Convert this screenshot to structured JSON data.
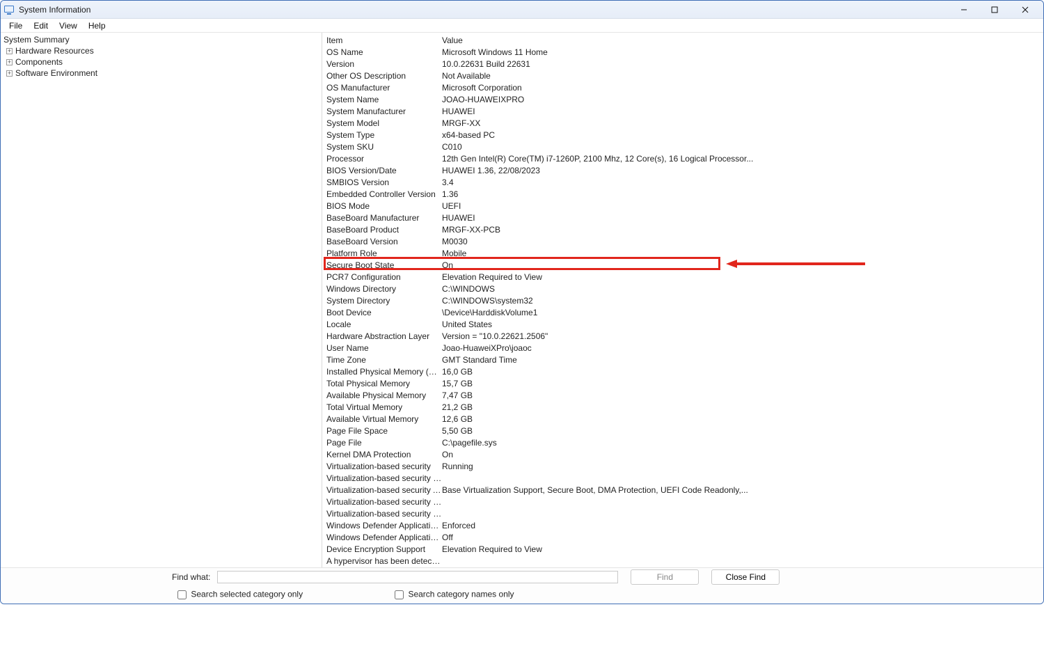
{
  "window": {
    "title": "System Information"
  },
  "menu": {
    "file": "File",
    "edit": "Edit",
    "view": "View",
    "help": "Help"
  },
  "tree": {
    "root": "System Summary",
    "hardware": "Hardware Resources",
    "components": "Components",
    "software": "Software Environment"
  },
  "columns": {
    "item": "Item",
    "value": "Value"
  },
  "rows": [
    {
      "item": "OS Name",
      "value": "Microsoft Windows 11 Home"
    },
    {
      "item": "Version",
      "value": "10.0.22631 Build 22631"
    },
    {
      "item": "Other OS Description",
      "value": "Not Available"
    },
    {
      "item": "OS Manufacturer",
      "value": "Microsoft Corporation"
    },
    {
      "item": "System Name",
      "value": "JOAO-HUAWEIXPRO"
    },
    {
      "item": "System Manufacturer",
      "value": "HUAWEI"
    },
    {
      "item": "System Model",
      "value": "MRGF-XX"
    },
    {
      "item": "System Type",
      "value": "x64-based PC"
    },
    {
      "item": "System SKU",
      "value": "C010"
    },
    {
      "item": "Processor",
      "value": "12th Gen Intel(R) Core(TM) i7-1260P, 2100 Mhz, 12 Core(s), 16 Logical Processor..."
    },
    {
      "item": "BIOS Version/Date",
      "value": "HUAWEI 1.36, 22/08/2023"
    },
    {
      "item": "SMBIOS Version",
      "value": "3.4"
    },
    {
      "item": "Embedded Controller Version",
      "value": "1.36"
    },
    {
      "item": "BIOS Mode",
      "value": "UEFI"
    },
    {
      "item": "BaseBoard Manufacturer",
      "value": "HUAWEI"
    },
    {
      "item": "BaseBoard Product",
      "value": "MRGF-XX-PCB"
    },
    {
      "item": "BaseBoard Version",
      "value": "M0030"
    },
    {
      "item": "Platform Role",
      "value": "Mobile"
    },
    {
      "item": "Secure Boot State",
      "value": "On",
      "hl": true
    },
    {
      "item": "PCR7 Configuration",
      "value": "Elevation Required to View"
    },
    {
      "item": "Windows Directory",
      "value": "C:\\WINDOWS"
    },
    {
      "item": "System Directory",
      "value": "C:\\WINDOWS\\system32"
    },
    {
      "item": "Boot Device",
      "value": "\\Device\\HarddiskVolume1"
    },
    {
      "item": "Locale",
      "value": "United States"
    },
    {
      "item": "Hardware Abstraction Layer",
      "value": "Version = \"10.0.22621.2506\""
    },
    {
      "item": "User Name",
      "value": "Joao-HuaweiXPro\\joaoc"
    },
    {
      "item": "Time Zone",
      "value": "GMT Standard Time"
    },
    {
      "item": "Installed Physical Memory (RAM)",
      "value": "16,0 GB"
    },
    {
      "item": "Total Physical Memory",
      "value": "15,7 GB"
    },
    {
      "item": "Available Physical Memory",
      "value": "7,47 GB"
    },
    {
      "item": "Total Virtual Memory",
      "value": "21,2 GB"
    },
    {
      "item": "Available Virtual Memory",
      "value": "12,6 GB"
    },
    {
      "item": "Page File Space",
      "value": "5,50 GB"
    },
    {
      "item": "Page File",
      "value": "C:\\pagefile.sys"
    },
    {
      "item": "Kernel DMA Protection",
      "value": "On"
    },
    {
      "item": "Virtualization-based security",
      "value": "Running"
    },
    {
      "item": "Virtualization-based security Re...",
      "value": ""
    },
    {
      "item": "Virtualization-based security Av...",
      "value": "Base Virtualization Support, Secure Boot, DMA Protection, UEFI Code Readonly,..."
    },
    {
      "item": "Virtualization-based security Se...",
      "value": ""
    },
    {
      "item": "Virtualization-based security Se...",
      "value": ""
    },
    {
      "item": "Windows Defender Application ...",
      "value": "Enforced"
    },
    {
      "item": "Windows Defender Application ...",
      "value": "Off"
    },
    {
      "item": "Device Encryption Support",
      "value": "Elevation Required to View"
    },
    {
      "item": "A hypervisor has been detected....",
      "value": ""
    }
  ],
  "find": {
    "label": "Find what:",
    "find_btn": "Find",
    "close_btn": "Close Find",
    "opt1": "Search selected category only",
    "opt2": "Search category names only"
  },
  "annotation": {
    "highlight_color": "#e1261c"
  }
}
